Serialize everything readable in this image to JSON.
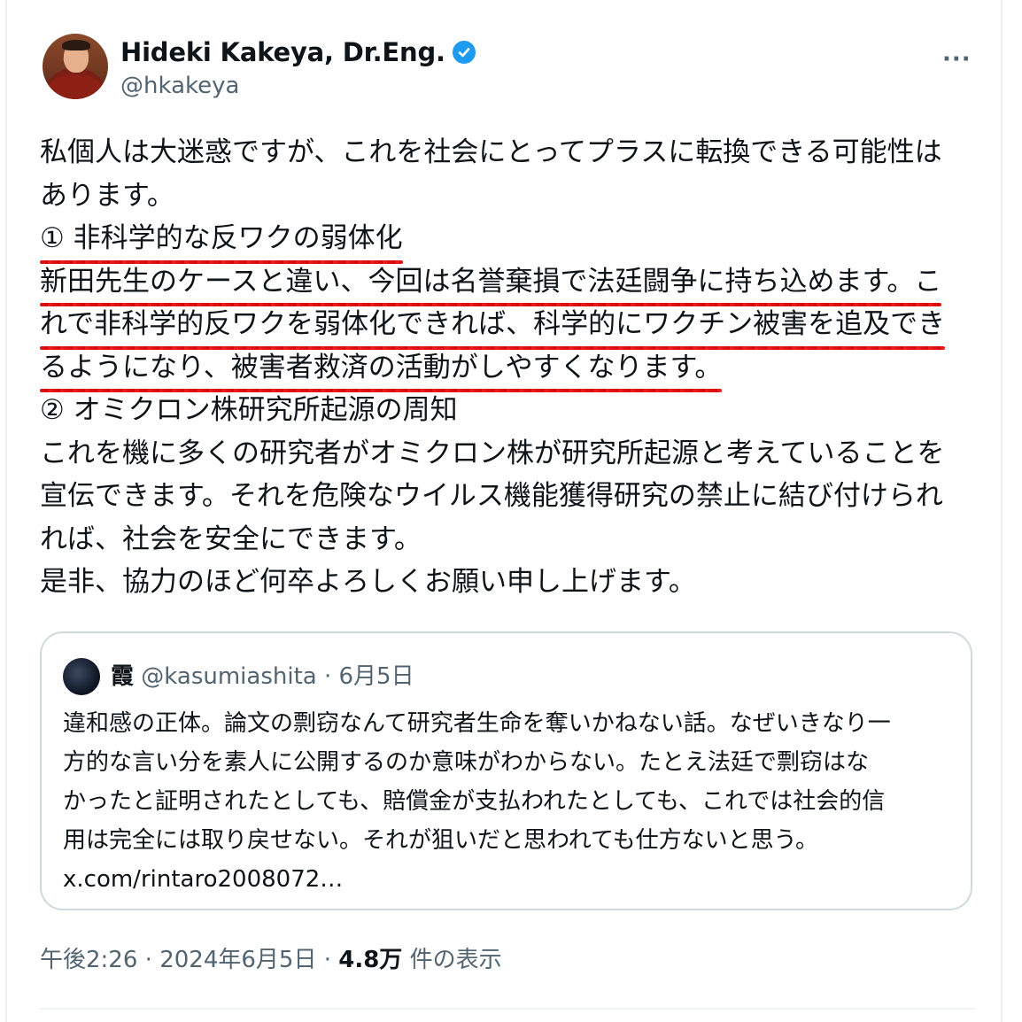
{
  "author": {
    "display_name": "Hideki Kakeya, Dr.Eng.",
    "handle": "@hkakeya",
    "verified": true,
    "avatar_icon": "profile-photo-avatar",
    "more_label": "···"
  },
  "tweet": {
    "lines": [
      "私個人は大迷惑ですが、これを社会にとってプラスに転換できる可能性は",
      "あります。",
      "① 非科学的な反ワクの弱体化",
      "新田先生のケースと違い、今回は名誉棄損で法廷闘争に持ち込めます。こ",
      "れで非科学的反ワクを弱体化できれば、科学的にワクチン被害を追及でき",
      "るようになり、被害者救済の活動がしやすくなります。",
      "② オミクロン株研究所起源の周知",
      "これを機に多くの研究者がオミクロン株が研究所起源と考えていることを",
      "宣伝できます。それを危険なウイルス機能獲得研究の禁止に結び付けられ",
      "れば、社会を安全にできます。",
      "是非、協力のほど何卒よろしくお願い申し上げます。"
    ],
    "underline_color": "#e01010"
  },
  "quote": {
    "name": "霞",
    "handle_date": " @kasumiashita · 6月5日",
    "lines": [
      "違和感の正体。論文の剽窃なんて研究者生命を奪いかねない話。なぜいきなり一",
      "方的な言い分を素人に公開するのか意味がわからない。たとえ法廷で剽窃はな",
      "かったと証明されたとしても、賠償金が支払われたとしても、これでは社会的信",
      "用は完全には取り戻せない。それが狙いだと思われても仕方ないと思う。",
      "x.com/rintaro2008072…"
    ]
  },
  "meta": {
    "time": "午後2:26",
    "sep1": " · ",
    "date": "2024年6月5日",
    "sep2": " · ",
    "views_count": "4.8万",
    "views_label": " 件の表示"
  },
  "colors": {
    "text": "#0f1419",
    "secondary": "#536471",
    "verified_blue": "#1d9bf0",
    "border": "#cfd9de"
  }
}
